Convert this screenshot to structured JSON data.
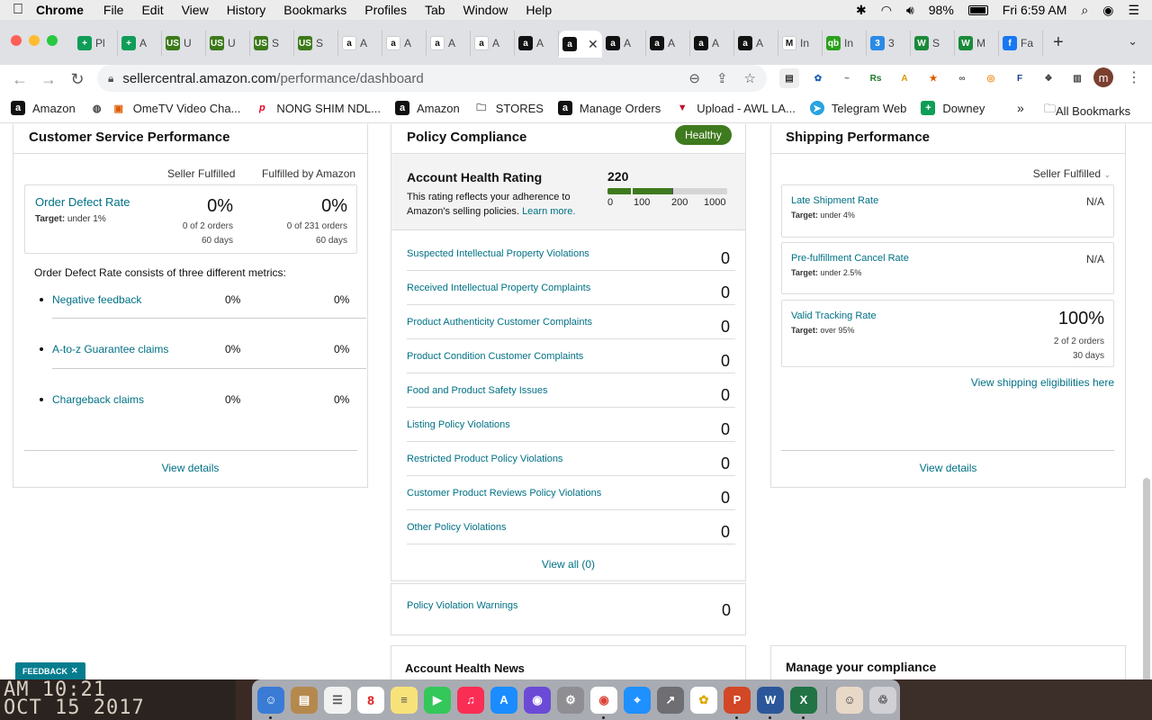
{
  "menubar": {
    "app": "Chrome",
    "items": [
      "File",
      "Edit",
      "View",
      "History",
      "Bookmarks",
      "Profiles",
      "Tab",
      "Window",
      "Help"
    ],
    "battery": "98%",
    "clock": "Fri 6:59 AM"
  },
  "tabs": [
    {
      "label": "Pl",
      "icon": "sheets-icon",
      "color": "#0f9d58",
      "glyph": "+"
    },
    {
      "label": "A",
      "icon": "sheets-icon",
      "color": "#0f9d58",
      "glyph": "+"
    },
    {
      "label": "U",
      "icon": "usfoods-icon",
      "color": "#3c7a1a",
      "glyph": "US"
    },
    {
      "label": "U",
      "icon": "usfoods-icon",
      "color": "#3c7a1a",
      "glyph": "US"
    },
    {
      "label": "S",
      "icon": "usfoods-icon",
      "color": "#3c7a1a",
      "glyph": "US"
    },
    {
      "label": "S",
      "icon": "usfoods-icon",
      "color": "#3c7a1a",
      "glyph": "US"
    },
    {
      "label": "A",
      "icon": "amazon-icon",
      "color": "#ffffff",
      "glyph": "a"
    },
    {
      "label": "A",
      "icon": "amazon-icon",
      "color": "#ffffff",
      "glyph": "a"
    },
    {
      "label": "A",
      "icon": "amazon-icon",
      "color": "#ffffff",
      "glyph": "a"
    },
    {
      "label": "A",
      "icon": "amazon-icon",
      "color": "#ffffff",
      "glyph": "a"
    },
    {
      "label": "A",
      "icon": "amazon-dark-icon",
      "color": "#111111",
      "glyph": "a"
    },
    {
      "label": "",
      "icon": "amazon-dark-icon",
      "color": "#111111",
      "glyph": "a",
      "active": true
    },
    {
      "label": "A",
      "icon": "amazon-dark-icon",
      "color": "#111111",
      "glyph": "a"
    },
    {
      "label": "A",
      "icon": "amazon-dark-icon",
      "color": "#111111",
      "glyph": "a"
    },
    {
      "label": "A",
      "icon": "amazon-dark-icon",
      "color": "#111111",
      "glyph": "a"
    },
    {
      "label": "A",
      "icon": "amazon-dark-icon",
      "color": "#111111",
      "glyph": "a"
    },
    {
      "label": "In",
      "icon": "gmail-icon",
      "color": "#ffffff",
      "glyph": "M"
    },
    {
      "label": "In",
      "icon": "quickbooks-icon",
      "color": "#2ca01c",
      "glyph": "qb"
    },
    {
      "label": "3",
      "icon": "numbered-icon",
      "color": "#2b8ae6",
      "glyph": "3"
    },
    {
      "label": "S",
      "icon": "wholesale-icon",
      "color": "#1b8a3a",
      "glyph": "W"
    },
    {
      "label": "M",
      "icon": "wholesale-icon",
      "color": "#1b8a3a",
      "glyph": "W"
    },
    {
      "label": "Fa",
      "icon": "facebook-icon",
      "color": "#1877f2",
      "glyph": "f"
    }
  ],
  "omnibox": {
    "host": "sellercentral.amazon.com",
    "path": "/performance/dashboard"
  },
  "profile": "m",
  "bookmarks": [
    {
      "label": "Amazon",
      "icon": "amazon-icon"
    },
    {
      "label": "OmeTV Video Cha...",
      "icon": "ometv-icon"
    },
    {
      "label": "NONG SHIM NDL...",
      "icon": "pinterest-icon"
    },
    {
      "label": "Amazon",
      "icon": "amazon-icon"
    },
    {
      "label": "STORES",
      "icon": "folder-icon"
    },
    {
      "label": "Manage Orders",
      "icon": "amazon-icon"
    },
    {
      "label": "Upload - AWL LA...",
      "icon": "awl-icon"
    },
    {
      "label": "Telegram Web",
      "icon": "telegram-icon"
    },
    {
      "label": "Downey",
      "icon": "sheets-icon"
    }
  ],
  "bookmarks_all": "All Bookmarks",
  "customer_service": {
    "title": "Customer Service Performance",
    "col_seller": "Seller Fulfilled",
    "col_fba": "Fulfilled by Amazon",
    "odr_name": "Order Defect Rate",
    "odr_target_label": "Target:",
    "odr_target_value": " under 1%",
    "seller_pct": "0%",
    "seller_orders": "0 of 2 orders",
    "seller_days": "60 days",
    "fba_pct": "0%",
    "fba_orders": "0 of 231 orders",
    "fba_days": "60 days",
    "consists": "Order Defect Rate consists of three different metrics:",
    "metrics": [
      {
        "name": "Negative feedback",
        "seller": "0%",
        "fba": "0%"
      },
      {
        "name": "A-to-z Guarantee claims",
        "seller": "0%",
        "fba": "0%"
      },
      {
        "name": "Chargeback claims",
        "seller": "0%",
        "fba": "0%"
      }
    ],
    "view_details": "View details"
  },
  "policy": {
    "title": "Policy Compliance",
    "badge": "Healthy",
    "ahr_title": "Account Health Rating",
    "ahr_desc": "This rating reflects your adherence to Amazon's selling policies.",
    "ahr_learn_more": "Learn more.",
    "ahr_score": "220",
    "ahr_ticks": [
      "0",
      "100",
      "200",
      "1000"
    ],
    "violations": [
      {
        "name": "Suspected Intellectual Property Violations",
        "count": "0"
      },
      {
        "name": "Received Intellectual Property Complaints",
        "count": "0"
      },
      {
        "name": "Product Authenticity Customer Complaints",
        "count": "0"
      },
      {
        "name": "Product Condition Customer Complaints",
        "count": "0"
      },
      {
        "name": "Food and Product Safety Issues",
        "count": "0"
      },
      {
        "name": "Listing Policy Violations",
        "count": "0"
      },
      {
        "name": "Restricted Product Policy Violations",
        "count": "0"
      },
      {
        "name": "Customer Product Reviews Policy Violations",
        "count": "0"
      },
      {
        "name": "Other Policy Violations",
        "count": "0"
      }
    ],
    "view_all": "View all (0)",
    "warnings_name": "Policy Violation Warnings",
    "warnings_count": "0"
  },
  "news": {
    "title": "Account Health News"
  },
  "shipping": {
    "title": "Shipping Performance",
    "filter": "Seller Fulfilled",
    "late_name": "Late Shipment Rate",
    "late_target_label": "Target:",
    "late_target_value": " under 4%",
    "late_value": "N/A",
    "cancel_name": "Pre-fulfillment Cancel Rate",
    "cancel_target_label": "Target:",
    "cancel_target_value": " under 2.5%",
    "cancel_value": "N/A",
    "vtr_name": "Valid Tracking Rate",
    "vtr_target_label": "Target:",
    "vtr_target_value": " over 95%",
    "vtr_value": "100%",
    "vtr_orders": "2 of 2 orders",
    "vtr_days": "30 days",
    "eligibility": "View shipping eligibilities here",
    "view_details": "View details"
  },
  "compliance": {
    "title": "Manage your compliance"
  },
  "feedback": "FEEDBACK",
  "desktop_clock_line1": "AM 10:21",
  "desktop_clock_line2": "OCT 15 2017",
  "dock_calendar_day": "8",
  "colors": {
    "link": "#007185",
    "healthy_green": "#3e7a1e",
    "feedback_teal": "#067d8f"
  }
}
